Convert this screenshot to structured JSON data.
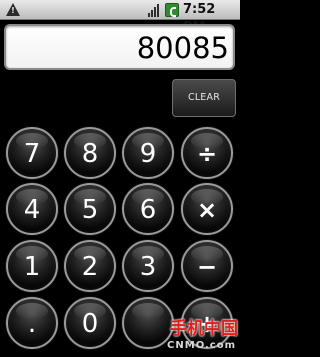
{
  "status_bar": {
    "time": "7:52 PM",
    "icons": [
      "warning-icon",
      "signal-icon",
      "battery-charging-icon"
    ]
  },
  "display": {
    "value": "80085"
  },
  "clear_button": {
    "label": "CLEAR"
  },
  "keypad": {
    "rows": [
      [
        "7",
        "8",
        "9",
        "÷"
      ],
      [
        "4",
        "5",
        "6",
        "×"
      ],
      [
        "1",
        "2",
        "3",
        "−"
      ],
      [
        ".",
        "0",
        "",
        "+"
      ]
    ]
  },
  "watermark": {
    "top": "手机中国",
    "bottom": "CNMO.com"
  }
}
